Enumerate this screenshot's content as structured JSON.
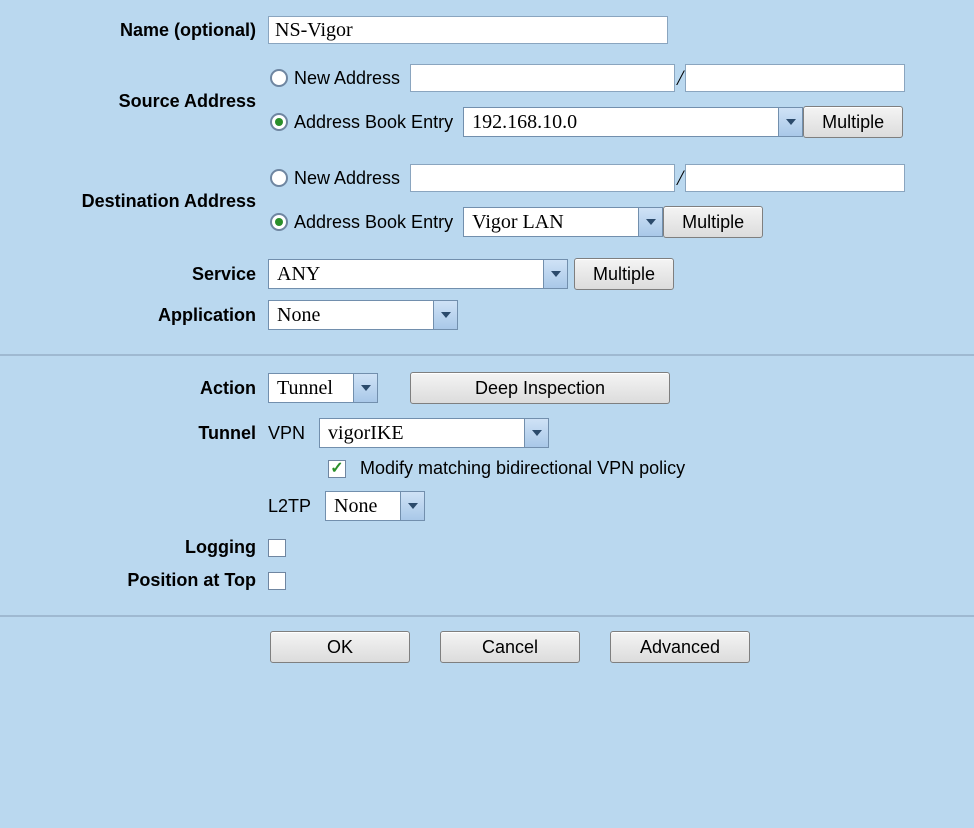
{
  "labels": {
    "name": "Name (optional)",
    "source": "Source Address",
    "destination": "Destination Address",
    "service": "Service",
    "application": "Application",
    "action": "Action",
    "tunnel": "Tunnel",
    "logging": "Logging",
    "position_top": "Position at Top"
  },
  "name_value": "NS-Vigor",
  "radio": {
    "new_address": "New Address",
    "book_entry": "Address Book Entry"
  },
  "source": {
    "selected": "book",
    "book_value": "192.168.10.0"
  },
  "destination": {
    "selected": "book",
    "book_value": "Vigor LAN"
  },
  "service_value": "ANY",
  "application_value": "None",
  "action_value": "Tunnel",
  "tunnel": {
    "vpn_label": "VPN",
    "vpn_value": "vigorIKE",
    "modify_label": "Modify matching bidirectional VPN policy",
    "modify_checked": true,
    "l2tp_label": "L2TP",
    "l2tp_value": "None"
  },
  "logging_checked": false,
  "position_top_checked": false,
  "buttons": {
    "multiple": "Multiple",
    "deep_inspection": "Deep Inspection",
    "ok": "OK",
    "cancel": "Cancel",
    "advanced": "Advanced"
  }
}
